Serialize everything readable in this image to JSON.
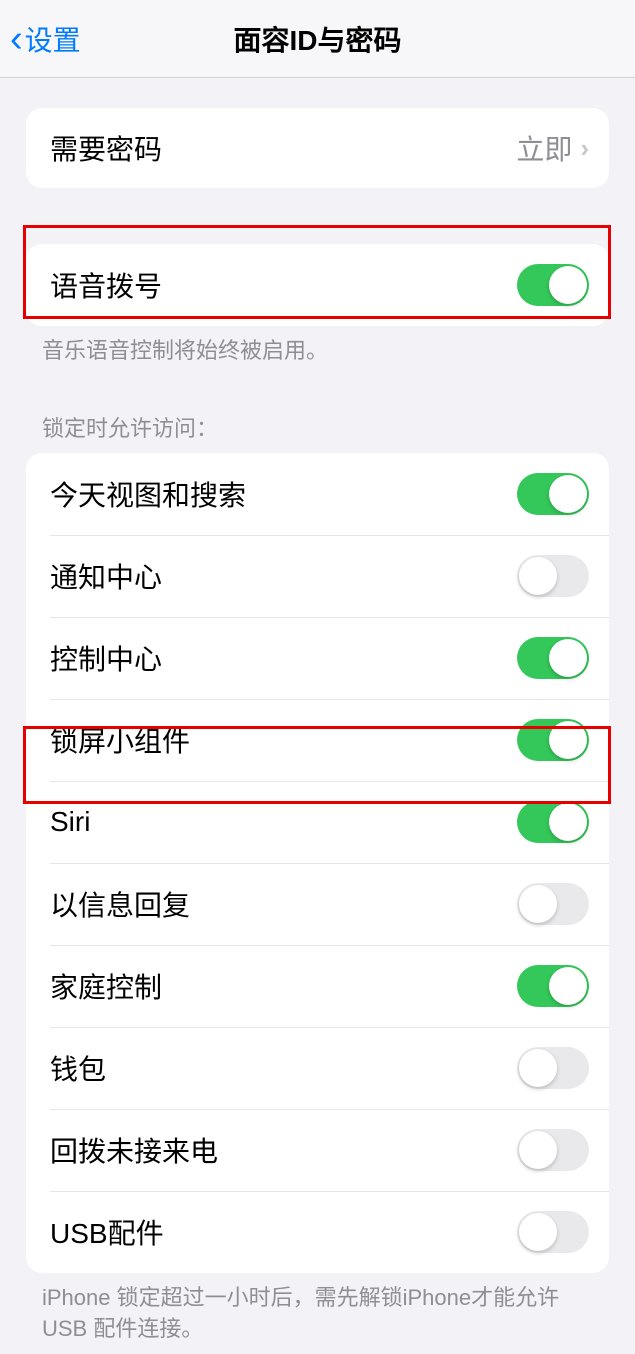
{
  "nav": {
    "back_label": "设置",
    "title": "面容ID与密码"
  },
  "passcode": {
    "label": "需要密码",
    "value": "立即"
  },
  "voice_dial": {
    "label": "语音拨号",
    "footer": "音乐语音控制将始终被启用。"
  },
  "locked_access": {
    "header": "锁定时允许访问：",
    "items": [
      {
        "label": "今天视图和搜索",
        "on": true
      },
      {
        "label": "通知中心",
        "on": false
      },
      {
        "label": "控制中心",
        "on": true
      },
      {
        "label": "锁屏小组件",
        "on": true
      },
      {
        "label": "Siri",
        "on": true
      },
      {
        "label": "以信息回复",
        "on": false
      },
      {
        "label": "家庭控制",
        "on": true
      },
      {
        "label": "钱包",
        "on": false
      },
      {
        "label": "回拨未接来电",
        "on": false
      },
      {
        "label": "USB配件",
        "on": false
      }
    ],
    "footer": "iPhone 锁定超过一小时后，需先解锁iPhone才能允许USB 配件连接。"
  }
}
